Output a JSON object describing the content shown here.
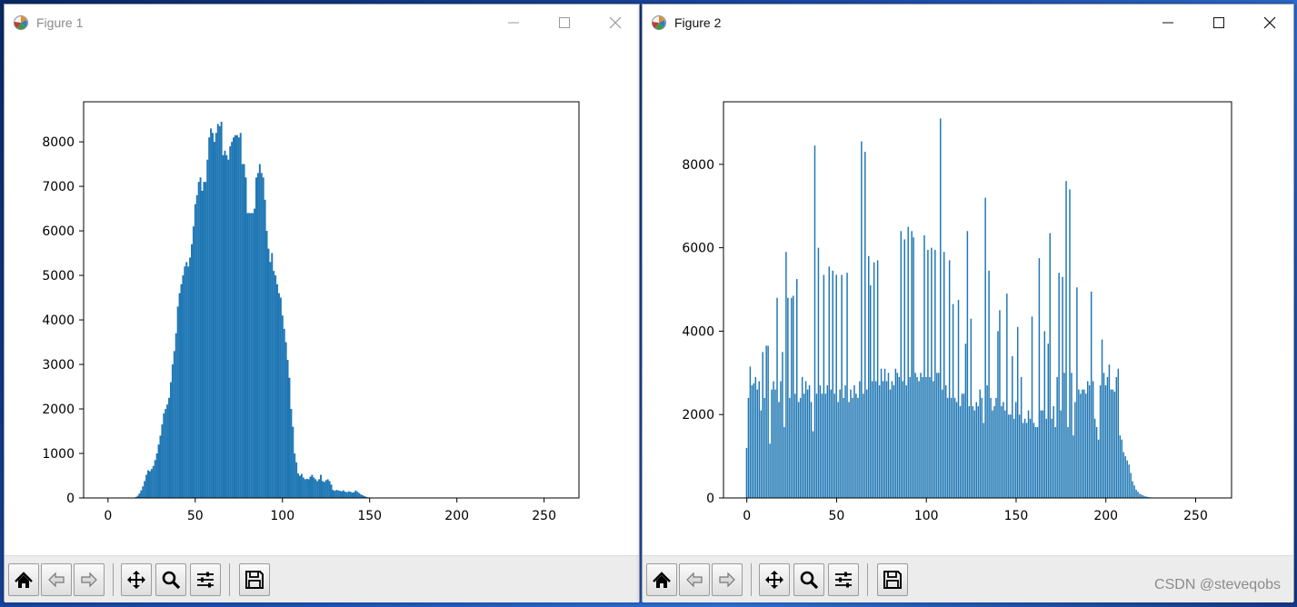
{
  "windows": [
    {
      "title": "Figure 1",
      "chart_data": {
        "type": "bar",
        "x": [
          16,
          17,
          18,
          19,
          20,
          21,
          22,
          23,
          24,
          25,
          26,
          27,
          28,
          29,
          30,
          31,
          32,
          33,
          34,
          35,
          36,
          37,
          38,
          39,
          40,
          41,
          42,
          43,
          44,
          45,
          46,
          47,
          48,
          49,
          50,
          51,
          52,
          53,
          54,
          55,
          56,
          57,
          58,
          59,
          60,
          61,
          62,
          63,
          64,
          65,
          66,
          67,
          68,
          69,
          70,
          71,
          72,
          73,
          74,
          75,
          76,
          77,
          78,
          79,
          80,
          81,
          82,
          83,
          84,
          85,
          86,
          87,
          88,
          89,
          90,
          91,
          92,
          93,
          94,
          95,
          96,
          97,
          98,
          99,
          100,
          101,
          102,
          103,
          104,
          105,
          106,
          107,
          108,
          109,
          110,
          111,
          112,
          113,
          114,
          115,
          116,
          117,
          118,
          119,
          120,
          121,
          122,
          123,
          124,
          125,
          126,
          127,
          128,
          129,
          130,
          131,
          132,
          133,
          134,
          135,
          136,
          137,
          138,
          139,
          140,
          141,
          142,
          143,
          144,
          145,
          146,
          147,
          148,
          149,
          150,
          151,
          152,
          153,
          154,
          155,
          156,
          157,
          158,
          159,
          160,
          161,
          162,
          163,
          164,
          165,
          166,
          167,
          168,
          169,
          170,
          171,
          172,
          173,
          174,
          175,
          176,
          177,
          178,
          179,
          180,
          181,
          182,
          183,
          184,
          185,
          186,
          187,
          188,
          189,
          190,
          191,
          192,
          193,
          194,
          195,
          196,
          197,
          198,
          199,
          200,
          201,
          202,
          203,
          204,
          205,
          206,
          207,
          208,
          209,
          210,
          211
        ],
        "values": [
          20,
          50,
          100,
          170,
          260,
          380,
          520,
          620,
          600,
          650,
          720,
          850,
          1000,
          1200,
          1400,
          1650,
          1900,
          2000,
          2100,
          2250,
          2600,
          3000,
          3300,
          3700,
          4300,
          4600,
          4800,
          5000,
          5200,
          5300,
          5200,
          5400,
          5700,
          6100,
          6600,
          6800,
          7100,
          7200,
          6900,
          7100,
          7100,
          7600,
          8100,
          8300,
          8200,
          8000,
          8200,
          8400,
          8350,
          8450,
          7700,
          7800,
          7700,
          7600,
          7900,
          8000,
          8100,
          8150,
          8150,
          8100,
          8200,
          7500,
          7500,
          7200,
          6400,
          6400,
          6400,
          6400,
          6500,
          7200,
          7300,
          7500,
          7300,
          7200,
          6700,
          6000,
          5600,
          5300,
          5500,
          5100,
          5000,
          4800,
          4600,
          4500,
          4100,
          3800,
          3500,
          3100,
          2700,
          2000,
          1600,
          1000,
          800,
          550,
          500,
          540,
          460,
          420,
          430,
          420,
          480,
          520,
          460,
          420,
          380,
          420,
          520,
          380,
          360,
          400,
          420,
          380,
          300,
          180,
          160,
          180,
          170,
          160,
          150,
          170,
          140,
          130,
          150,
          140,
          120,
          130,
          170,
          140,
          110,
          80,
          60,
          40,
          25,
          15,
          8,
          4,
          2,
          1,
          1,
          1,
          0,
          0,
          0,
          0,
          0,
          0,
          0,
          0,
          0,
          0,
          0,
          0,
          0,
          0,
          0,
          0,
          0,
          0,
          0,
          0,
          0,
          0,
          0,
          0,
          0,
          0,
          0,
          0,
          0,
          0,
          0,
          0,
          0,
          0,
          0,
          0,
          0,
          0,
          0,
          0,
          0,
          0,
          0,
          0,
          0,
          0,
          0,
          0,
          0,
          0,
          0,
          0,
          0,
          0,
          0,
          0,
          0,
          0,
          0,
          0,
          0,
          0,
          0
        ],
        "xlim": [
          -14,
          270
        ],
        "ylim": [
          0,
          8900
        ],
        "xticks": [
          0,
          50,
          100,
          150,
          200,
          250
        ],
        "yticks": [
          0,
          1000,
          2000,
          3000,
          4000,
          5000,
          6000,
          7000,
          8000
        ],
        "color": "#1f77b4"
      }
    },
    {
      "title": "Figure 2",
      "chart_data": {
        "type": "bar",
        "x": [
          0,
          1,
          2,
          3,
          4,
          5,
          6,
          7,
          8,
          9,
          10,
          11,
          12,
          13,
          14,
          15,
          16,
          17,
          18,
          19,
          20,
          21,
          22,
          23,
          24,
          25,
          26,
          27,
          28,
          29,
          30,
          31,
          32,
          33,
          34,
          35,
          36,
          37,
          38,
          39,
          40,
          41,
          42,
          43,
          44,
          45,
          46,
          47,
          48,
          49,
          50,
          51,
          52,
          53,
          54,
          55,
          56,
          57,
          58,
          59,
          60,
          61,
          62,
          63,
          64,
          65,
          66,
          67,
          68,
          69,
          70,
          71,
          72,
          73,
          74,
          75,
          76,
          77,
          78,
          79,
          80,
          81,
          82,
          83,
          84,
          85,
          86,
          87,
          88,
          89,
          90,
          91,
          92,
          93,
          94,
          95,
          96,
          97,
          98,
          99,
          100,
          101,
          102,
          103,
          104,
          105,
          106,
          107,
          108,
          109,
          110,
          111,
          112,
          113,
          114,
          115,
          116,
          117,
          118,
          119,
          120,
          121,
          122,
          123,
          124,
          125,
          126,
          127,
          128,
          129,
          130,
          131,
          132,
          133,
          134,
          135,
          136,
          137,
          138,
          139,
          140,
          141,
          142,
          143,
          144,
          145,
          146,
          147,
          148,
          149,
          150,
          151,
          152,
          153,
          154,
          155,
          156,
          157,
          158,
          159,
          160,
          161,
          162,
          163,
          164,
          165,
          166,
          167,
          168,
          169,
          170,
          171,
          172,
          173,
          174,
          175,
          176,
          177,
          178,
          179,
          180,
          181,
          182,
          183,
          184,
          185,
          186,
          187,
          188,
          189,
          190,
          191,
          192,
          193,
          194,
          195,
          196,
          197,
          198,
          199,
          200,
          201,
          202,
          203,
          204,
          205,
          206,
          207,
          208,
          209,
          210,
          211,
          212,
          213,
          214,
          215,
          216,
          217,
          218,
          219,
          220,
          221,
          222,
          223,
          224,
          225,
          226,
          227,
          228,
          229,
          230,
          231,
          232,
          233,
          234,
          235,
          236,
          237,
          238,
          239,
          240,
          241,
          242,
          243,
          244,
          245,
          246,
          247,
          248,
          249,
          250,
          251,
          252,
          253,
          254,
          255
        ],
        "values": [
          1200,
          2400,
          3150,
          2700,
          2750,
          2900,
          2600,
          2800,
          2100,
          3500,
          2400,
          3650,
          3650,
          1300,
          2600,
          2800,
          2600,
          4800,
          2300,
          2800,
          3500,
          1700,
          5900,
          4800,
          2400,
          4800,
          4850,
          2500,
          5250,
          2300,
          2400,
          2900,
          2500,
          2800,
          2600,
          2700,
          2300,
          1600,
          8450,
          2500,
          6000,
          2700,
          2500,
          5350,
          2500,
          2700,
          5550,
          2600,
          5450,
          2500,
          5350,
          2300,
          2600,
          5350,
          2400,
          2700,
          5400,
          2300,
          2600,
          2400,
          2700,
          2500,
          2400,
          2800,
          8550,
          2500,
          8300,
          2600,
          5800,
          5100,
          2800,
          5650,
          2800,
          5700,
          2700,
          3100,
          2800,
          3100,
          2800,
          3000,
          2600,
          2800,
          2700,
          3100,
          3000,
          2900,
          6400,
          2800,
          6200,
          2700,
          6500,
          2900,
          6400,
          6250,
          3000,
          2900,
          2800,
          3000,
          2900,
          6300,
          2900,
          5950,
          2900,
          6000,
          2800,
          5950,
          3000,
          3000,
          9100,
          2600,
          5900,
          2700,
          2400,
          5700,
          2400,
          4650,
          2400,
          2300,
          4750,
          2200,
          2500,
          2500,
          3700,
          6400,
          2200,
          4300,
          2200,
          2100,
          2300,
          2200,
          2600,
          2400,
          1800,
          7200,
          2700,
          5450,
          2400,
          2100,
          2200,
          2400,
          4000,
          4500,
          2200,
          2300,
          2100,
          4900,
          2000,
          2000,
          3400,
          1900,
          2300,
          4100,
          2000,
          2900,
          1800,
          1900,
          1800,
          2100,
          1900,
          4350,
          1800,
          1700,
          1700,
          5750,
          2100,
          2100,
          4000,
          1900,
          3700,
          6350,
          1900,
          2200,
          1700,
          2900,
          5400,
          2100,
          5300,
          3000,
          7600,
          1700,
          7400,
          3000,
          1500,
          2300,
          5050,
          2600,
          2500,
          2600,
          2600,
          2500,
          2800,
          2700,
          4950,
          2800,
          1900,
          1700,
          1400,
          2700,
          3800,
          3000,
          2700,
          2900,
          3200,
          2600,
          2600,
          2550,
          2900,
          3100,
          1500,
          1400,
          1100,
          1000,
          900,
          800,
          600,
          400,
          300,
          200,
          150,
          100,
          80,
          60,
          40,
          30,
          20,
          15,
          10,
          8,
          5,
          3,
          2,
          1,
          1,
          1,
          1,
          1,
          1,
          1,
          1,
          1,
          1,
          1,
          1,
          1,
          1,
          1,
          1,
          1,
          1,
          1,
          1,
          1,
          1,
          1,
          1,
          1,
          1,
          1,
          1,
          1,
          1,
          1
        ],
        "xlim": [
          -13,
          270
        ],
        "ylim": [
          0,
          9500
        ],
        "xticks": [
          0,
          50,
          100,
          150,
          200,
          250
        ],
        "yticks": [
          0,
          2000,
          4000,
          6000,
          8000
        ],
        "color": "#1f77b4"
      }
    }
  ],
  "toolbar": {
    "buttons": [
      {
        "name": "home-icon",
        "icon": "home"
      },
      {
        "name": "back-arrow-icon",
        "icon": "back"
      },
      {
        "name": "forward-arrow-icon",
        "icon": "forward"
      },
      {
        "name": "pan-move-icon",
        "icon": "pan"
      },
      {
        "name": "zoom-magnifier-icon",
        "icon": "zoom"
      },
      {
        "name": "configure-subplots-icon",
        "icon": "sliders"
      },
      {
        "name": "save-floppy-icon",
        "icon": "save"
      }
    ]
  },
  "watermark": "CSDN @steveqobs"
}
